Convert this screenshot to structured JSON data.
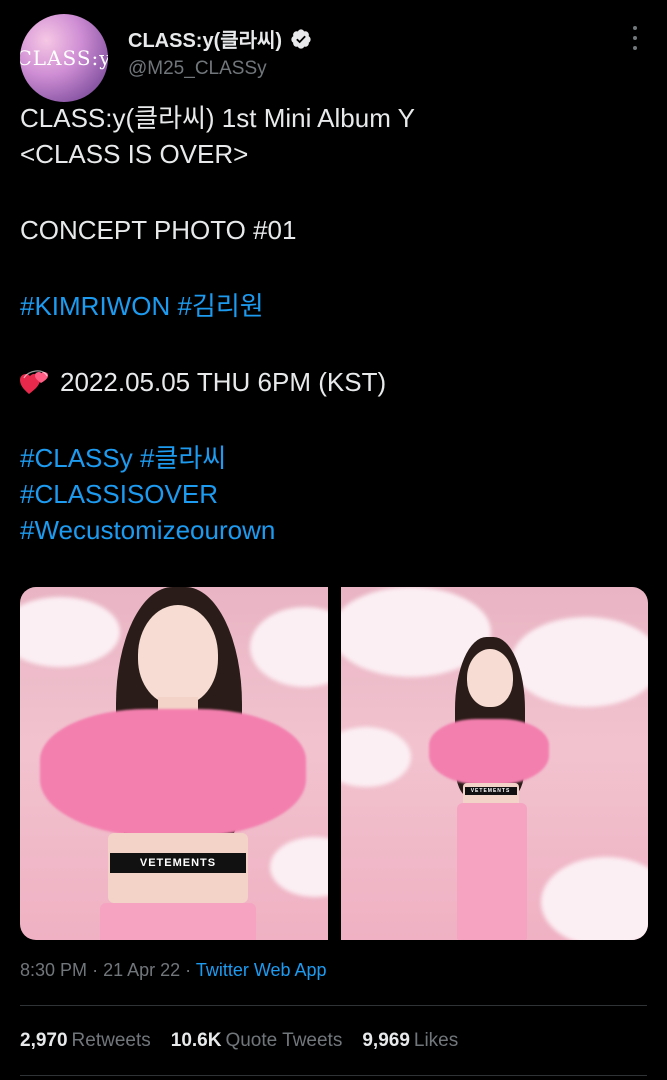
{
  "author": {
    "display_name": "CLASS:y(클라씨)",
    "handle": "@M25_CLASSy",
    "avatar_text": "CLASS:y",
    "verified": true,
    "verified_icon": "verified-badge-icon"
  },
  "tweet": {
    "lines": [
      "CLASS:y(클라씨) 1st Mini Album Y",
      "<CLASS IS OVER>",
      "CONCEPT PHOTO #01"
    ],
    "hashtags_member": [
      "#KIMRIWON",
      "#김리원"
    ],
    "date_line": "2022.05.05 THU 6PM (KST)",
    "date_emoji": "revolving-hearts-icon",
    "hashtags_group": [
      "#CLASSy",
      "#클라씨"
    ],
    "hashtag_album": "#CLASSISOVER",
    "hashtag_motto": "#Wecustomizeourown"
  },
  "media": {
    "photos": [
      {
        "band_text": "VETEMENTS"
      },
      {
        "band_text": "VETEMENTS"
      }
    ]
  },
  "meta": {
    "time": "8:30 PM",
    "separator": "·",
    "date": "21 Apr 22",
    "source": "Twitter Web App"
  },
  "stats": [
    {
      "value": "2,970",
      "label": "Retweets"
    },
    {
      "value": "10.6K",
      "label": "Quote Tweets"
    },
    {
      "value": "9,969",
      "label": "Likes"
    }
  ],
  "colors": {
    "background": "#000000",
    "text": "#e7e9ea",
    "secondary_text": "#71767b",
    "link": "#1d9bf0",
    "divider": "#2f3336"
  }
}
